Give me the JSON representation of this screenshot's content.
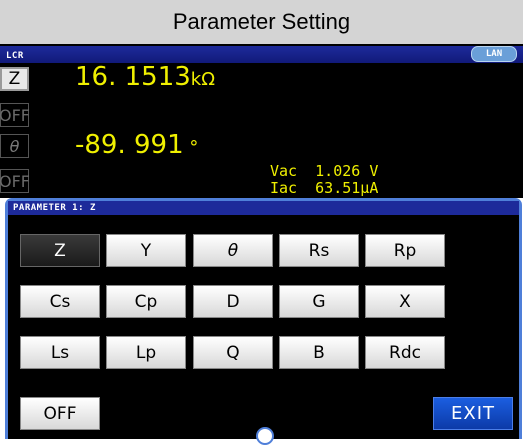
{
  "title": "Parameter Setting",
  "screen": {
    "mode_label": "LCR",
    "lan_badge": "LAN",
    "params": [
      {
        "label": "Z",
        "state": "active"
      },
      {
        "label": "OFF",
        "state": "off"
      },
      {
        "label": "θ",
        "state": "inactive"
      },
      {
        "label": "OFF",
        "state": "off"
      }
    ],
    "readings": [
      {
        "value": "16. 1513",
        "unit": "kΩ"
      },
      {
        "value": "-89. 991",
        "unit": " °"
      }
    ],
    "monitor": [
      {
        "label": "Vac",
        "value": "1.026 V"
      },
      {
        "label": "Iac",
        "value": "63.51μA"
      }
    ]
  },
  "panel": {
    "header": "PARAMETER 1:  Z",
    "selected": "Z",
    "buttons": [
      [
        "Z",
        "Y",
        "θ",
        "Rs",
        "Rp"
      ],
      [
        "Cs",
        "Cp",
        "D",
        "G",
        "X"
      ],
      [
        "Ls",
        "Lp",
        "Q",
        "B",
        "Rdc"
      ]
    ],
    "off_label": "OFF",
    "exit_label": "EXIT"
  },
  "colors": {
    "accent_blue": "#4f7fd9",
    "reading_yellow": "#f0f000",
    "header_blue": "#1d2a9a",
    "exit_blue": "#1b5ee0"
  }
}
